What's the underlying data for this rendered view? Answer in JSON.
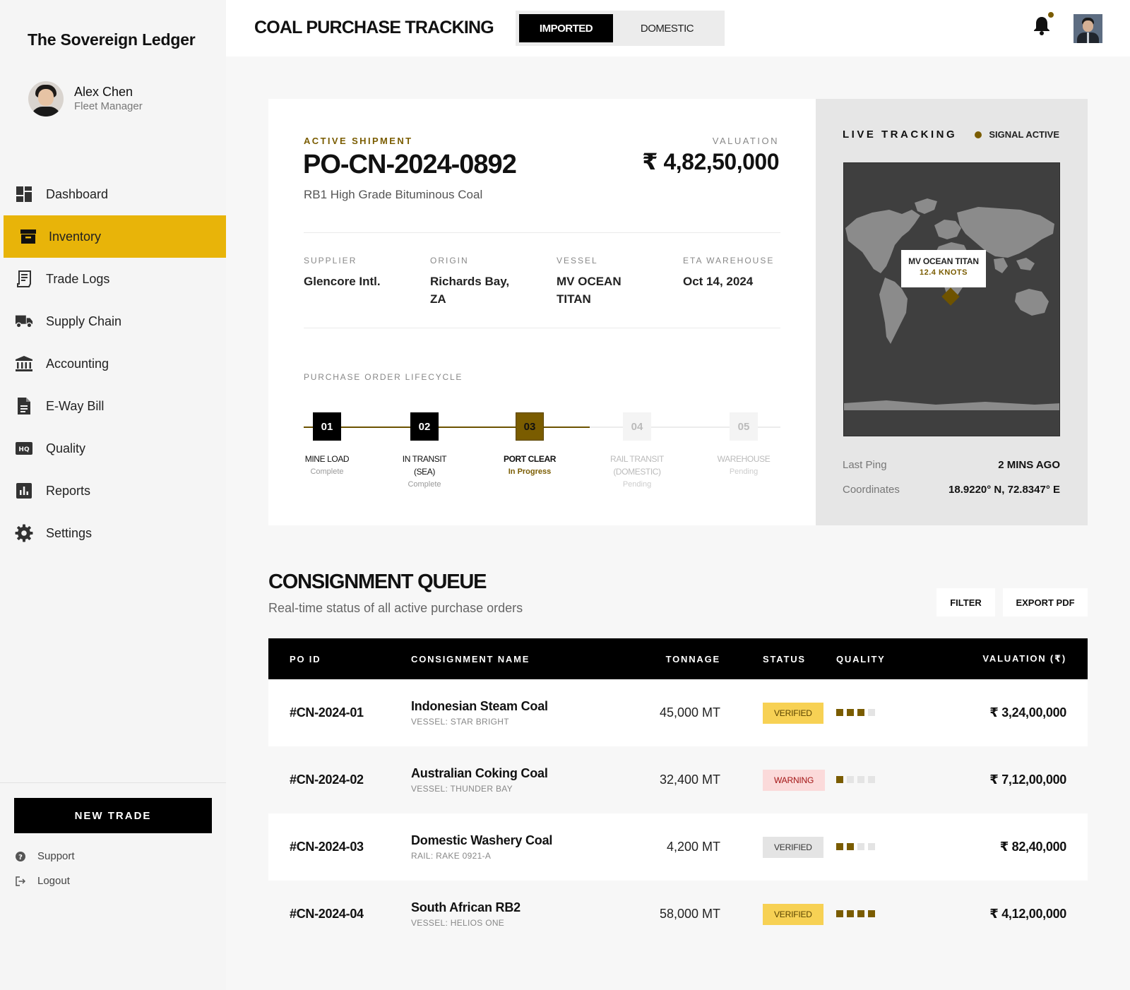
{
  "sidebar": {
    "brand": "The Sovereign Ledger",
    "user": {
      "name": "Alex Chen",
      "role": "Fleet Manager"
    },
    "nav": [
      {
        "label": "Dashboard",
        "icon": "dashboard-icon"
      },
      {
        "label": "Inventory",
        "icon": "inventory-icon",
        "active": true
      },
      {
        "label": "Trade Logs",
        "icon": "receipt-icon"
      },
      {
        "label": "Supply Chain",
        "icon": "truck-icon"
      },
      {
        "label": "Accounting",
        "icon": "bank-icon"
      },
      {
        "label": "E-Way Bill",
        "icon": "document-icon"
      },
      {
        "label": "Quality",
        "icon": "hq-icon"
      },
      {
        "label": "Reports",
        "icon": "bar-chart-icon"
      },
      {
        "label": "Settings",
        "icon": "gear-icon"
      }
    ],
    "new_trade": "NEW TRADE",
    "support": "Support",
    "logout": "Logout"
  },
  "header": {
    "title": "COAL PURCHASE TRACKING",
    "segments": [
      "IMPORTED",
      "DOMESTIC"
    ],
    "active_segment": "IMPORTED"
  },
  "shipment": {
    "eyebrow": "ACTIVE SHIPMENT",
    "po": "PO-CN-2024-0892",
    "product": "RB1 High Grade Bituminous Coal",
    "valuation_label": "VALUATION",
    "valuation": "₹ 4,82,50,000",
    "meta": [
      {
        "label": "SUPPLIER",
        "value": "Glencore Intl."
      },
      {
        "label": "ORIGIN",
        "value": "Richards Bay, ZA"
      },
      {
        "label": "VESSEL",
        "value": "MV OCEAN TITAN"
      },
      {
        "label": "ETA WAREHOUSE",
        "value": "Oct 14, 2024"
      }
    ],
    "lifecycle_label": "PURCHASE ORDER LIFECYCLE",
    "steps": [
      {
        "num": "01",
        "name": "MINE LOAD",
        "state": "Complete",
        "status": "complete"
      },
      {
        "num": "02",
        "name": "IN TRANSIT (SEA)",
        "state": "Complete",
        "status": "complete"
      },
      {
        "num": "03",
        "name": "PORT CLEAR",
        "state": "In Progress",
        "status": "progress"
      },
      {
        "num": "04",
        "name": "RAIL TRANSIT (DOMESTIC)",
        "state": "Pending",
        "status": "pending"
      },
      {
        "num": "05",
        "name": "WAREHOUSE",
        "state": "Pending",
        "status": "pending"
      }
    ]
  },
  "tracking": {
    "title": "LIVE TRACKING",
    "signal": "SIGNAL ACTIVE",
    "vessel": "MV OCEAN TITAN",
    "speed": "12.4 KNOTS",
    "last_ping_label": "Last Ping",
    "last_ping": "2 MINS AGO",
    "coords_label": "Coordinates",
    "coords": "18.9220° N, 72.8347° E"
  },
  "queue": {
    "title": "CONSIGNMENT QUEUE",
    "subtitle": "Real-time status of all active purchase orders",
    "filter": "FILTER",
    "export": "EXPORT PDF",
    "columns": [
      "PO ID",
      "CONSIGNMENT NAME",
      "TONNAGE",
      "STATUS",
      "QUALITY",
      "VALUATION (₹)"
    ],
    "rows": [
      {
        "id": "#CN-2024-01",
        "name": "Indonesian Steam Coal",
        "vessel": "VESSEL: STAR BRIGHT",
        "tonnage": "45,000 MT",
        "status": "VERIFIED",
        "status_kind": "gold",
        "quality": 3,
        "valuation": "₹ 3,24,00,000"
      },
      {
        "id": "#CN-2024-02",
        "name": "Australian Coking Coal",
        "vessel": "VESSEL: THUNDER BAY",
        "tonnage": "32,400 MT",
        "status": "WARNING",
        "status_kind": "warn",
        "quality": 1,
        "valuation": "₹ 7,12,00,000"
      },
      {
        "id": "#CN-2024-03",
        "name": "Domestic Washery Coal",
        "vessel": "RAIL: RAKE 0921-A",
        "tonnage": "4,200 MT",
        "status": "VERIFIED",
        "status_kind": "grey",
        "quality": 2,
        "valuation": "₹ 82,40,000"
      },
      {
        "id": "#CN-2024-04",
        "name": "South African RB2",
        "vessel": "VESSEL: HELIOS ONE",
        "tonnage": "58,000 MT",
        "status": "VERIFIED",
        "status_kind": "gold",
        "quality": 4,
        "valuation": "₹ 4,12,00,000"
      }
    ]
  },
  "colors": {
    "accent": "#e8b409",
    "gold_dark": "#7a5c00",
    "warn_bg": "#fbdada",
    "warn_text": "#a31515",
    "gold_badge": "#f7d154",
    "grey_badge": "#e4e4e4"
  }
}
